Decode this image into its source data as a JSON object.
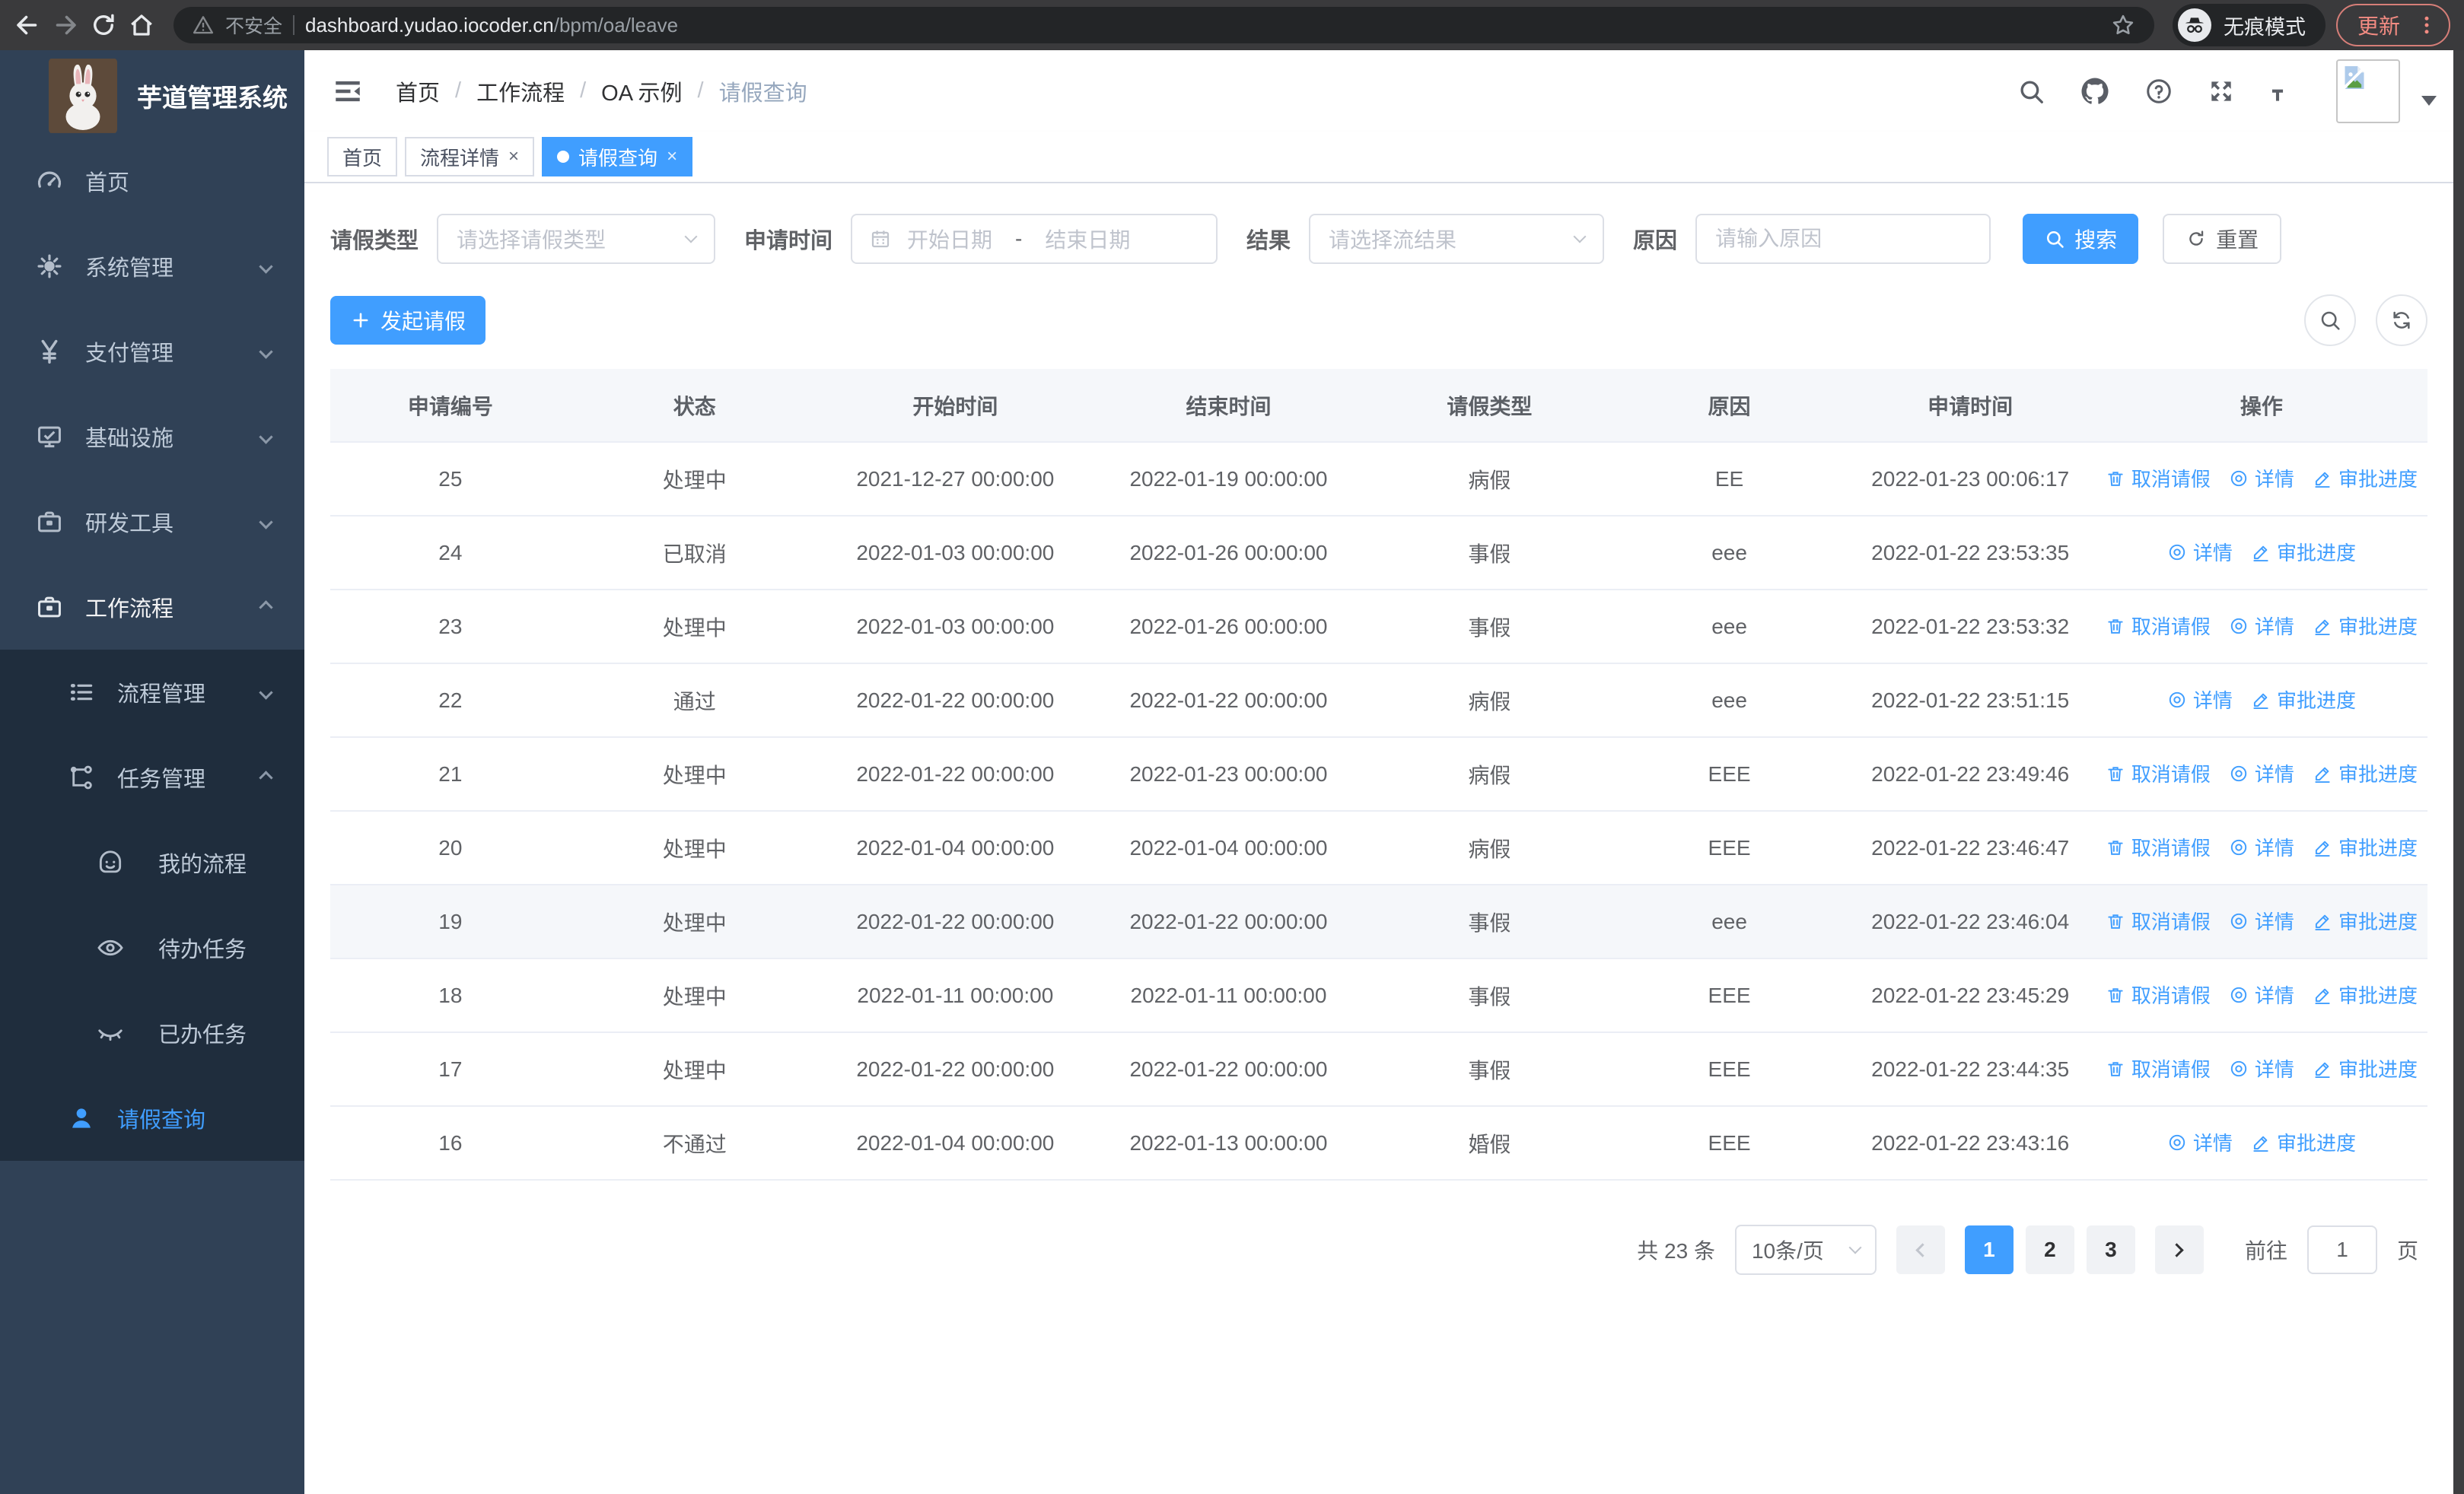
{
  "browser": {
    "security_label": "不安全",
    "url_domain": "dashboard.yudao.iocoder.cn",
    "url_path": "/bpm/oa/leave",
    "incognito_label": "无痕模式",
    "update_label": "更新"
  },
  "sidebar": {
    "title": "芋道管理系统",
    "items": [
      {
        "key": "home",
        "label": "首页",
        "icon": "dashboard-icon",
        "depth": 1
      },
      {
        "key": "system",
        "label": "系统管理",
        "icon": "gear-icon",
        "depth": 1,
        "chevron": "down"
      },
      {
        "key": "payment",
        "label": "支付管理",
        "icon": "yen-icon",
        "depth": 1,
        "chevron": "down"
      },
      {
        "key": "infra",
        "label": "基础设施",
        "icon": "monitor-icon",
        "depth": 1,
        "chevron": "down"
      },
      {
        "key": "devtools",
        "label": "研发工具",
        "icon": "briefcase-icon",
        "depth": 1,
        "chevron": "down"
      },
      {
        "key": "workflow",
        "label": "工作流程",
        "icon": "briefcase-icon",
        "depth": 1,
        "chevron": "up",
        "expanded": true
      },
      {
        "key": "process-mgmt",
        "label": "流程管理",
        "icon": "list-icon",
        "depth": 2,
        "chevron": "down",
        "sub": true
      },
      {
        "key": "task-mgmt",
        "label": "任务管理",
        "icon": "flow-icon",
        "depth": 2,
        "chevron": "up",
        "sub": true
      },
      {
        "key": "my-process",
        "label": "我的流程",
        "icon": "robot-icon",
        "depth": 3,
        "sub": true
      },
      {
        "key": "todo-tasks",
        "label": "待办任务",
        "icon": "eye-icon",
        "depth": 3,
        "sub": true
      },
      {
        "key": "done-tasks",
        "label": "已办任务",
        "icon": "eye-closed-icon",
        "depth": 3,
        "sub": true
      },
      {
        "key": "leave-query",
        "label": "请假查询",
        "icon": "user-icon",
        "depth": 2,
        "sub": true,
        "active": true
      }
    ]
  },
  "header": {
    "breadcrumb": [
      "首页",
      "工作流程",
      "OA 示例",
      "请假查询"
    ],
    "breadcrumb_separator": "/"
  },
  "tabs": [
    {
      "key": "home",
      "label": "首页",
      "closable": false,
      "active": false
    },
    {
      "key": "process-detail",
      "label": "流程详情",
      "closable": true,
      "active": false
    },
    {
      "key": "leave-query",
      "label": "请假查询",
      "closable": true,
      "active": true
    }
  ],
  "filters": {
    "leave_type_label": "请假类型",
    "leave_type_placeholder": "请选择请假类型",
    "apply_time_label": "申请时间",
    "date_start_placeholder": "开始日期",
    "date_separator": "-",
    "date_end_placeholder": "结束日期",
    "result_label": "结果",
    "result_placeholder": "请选择流结果",
    "reason_label": "原因",
    "reason_placeholder": "请输入原因",
    "search_label": "搜索",
    "reset_label": "重置"
  },
  "toolbar": {
    "create_label": "发起请假"
  },
  "table": {
    "columns": [
      "申请编号",
      "状态",
      "开始时间",
      "结束时间",
      "请假类型",
      "原因",
      "申请时间",
      "操作"
    ],
    "action_labels": {
      "cancel": "取消请假",
      "detail": "详情",
      "progress": "审批进度"
    },
    "rows": [
      {
        "id": "25",
        "status": "处理中",
        "start": "2021-12-27 00:00:00",
        "end": "2022-01-19 00:00:00",
        "type": "病假",
        "reason": "EE",
        "apply_time": "2022-01-23 00:06:17",
        "actions": [
          "cancel",
          "detail",
          "progress"
        ]
      },
      {
        "id": "24",
        "status": "已取消",
        "start": "2022-01-03 00:00:00",
        "end": "2022-01-26 00:00:00",
        "type": "事假",
        "reason": "eee",
        "apply_time": "2022-01-22 23:53:35",
        "actions": [
          "detail",
          "progress"
        ]
      },
      {
        "id": "23",
        "status": "处理中",
        "start": "2022-01-03 00:00:00",
        "end": "2022-01-26 00:00:00",
        "type": "事假",
        "reason": "eee",
        "apply_time": "2022-01-22 23:53:32",
        "actions": [
          "cancel",
          "detail",
          "progress"
        ]
      },
      {
        "id": "22",
        "status": "通过",
        "start": "2022-01-22 00:00:00",
        "end": "2022-01-22 00:00:00",
        "type": "病假",
        "reason": "eee",
        "apply_time": "2022-01-22 23:51:15",
        "actions": [
          "detail",
          "progress"
        ]
      },
      {
        "id": "21",
        "status": "处理中",
        "start": "2022-01-22 00:00:00",
        "end": "2022-01-23 00:00:00",
        "type": "病假",
        "reason": "EEE",
        "apply_time": "2022-01-22 23:49:46",
        "actions": [
          "cancel",
          "detail",
          "progress"
        ]
      },
      {
        "id": "20",
        "status": "处理中",
        "start": "2022-01-04 00:00:00",
        "end": "2022-01-04 00:00:00",
        "type": "病假",
        "reason": "EEE",
        "apply_time": "2022-01-22 23:46:47",
        "actions": [
          "cancel",
          "detail",
          "progress"
        ]
      },
      {
        "id": "19",
        "status": "处理中",
        "start": "2022-01-22 00:00:00",
        "end": "2022-01-22 00:00:00",
        "type": "事假",
        "reason": "eee",
        "apply_time": "2022-01-22 23:46:04",
        "actions": [
          "cancel",
          "detail",
          "progress"
        ],
        "highlighted": true
      },
      {
        "id": "18",
        "status": "处理中",
        "start": "2022-01-11 00:00:00",
        "end": "2022-01-11 00:00:00",
        "type": "事假",
        "reason": "EEE",
        "apply_time": "2022-01-22 23:45:29",
        "actions": [
          "cancel",
          "detail",
          "progress"
        ]
      },
      {
        "id": "17",
        "status": "处理中",
        "start": "2022-01-22 00:00:00",
        "end": "2022-01-22 00:00:00",
        "type": "事假",
        "reason": "EEE",
        "apply_time": "2022-01-22 23:44:35",
        "actions": [
          "cancel",
          "detail",
          "progress"
        ]
      },
      {
        "id": "16",
        "status": "不通过",
        "start": "2022-01-04 00:00:00",
        "end": "2022-01-13 00:00:00",
        "type": "婚假",
        "reason": "EEE",
        "apply_time": "2022-01-22 23:43:16",
        "actions": [
          "detail",
          "progress"
        ]
      }
    ]
  },
  "pagination": {
    "total_label": "共 23 条",
    "page_size": "10条/页",
    "pages": [
      "1",
      "2",
      "3"
    ],
    "active_page": "1",
    "goto_label": "前往",
    "goto_value": "1",
    "page_unit": "页"
  },
  "colors": {
    "accent": "#409eff",
    "sidebar_bg": "#304156",
    "submenu_bg": "#1f2d3d",
    "table_header_bg": "#f5f7fa",
    "update_button": "#f28b82"
  }
}
